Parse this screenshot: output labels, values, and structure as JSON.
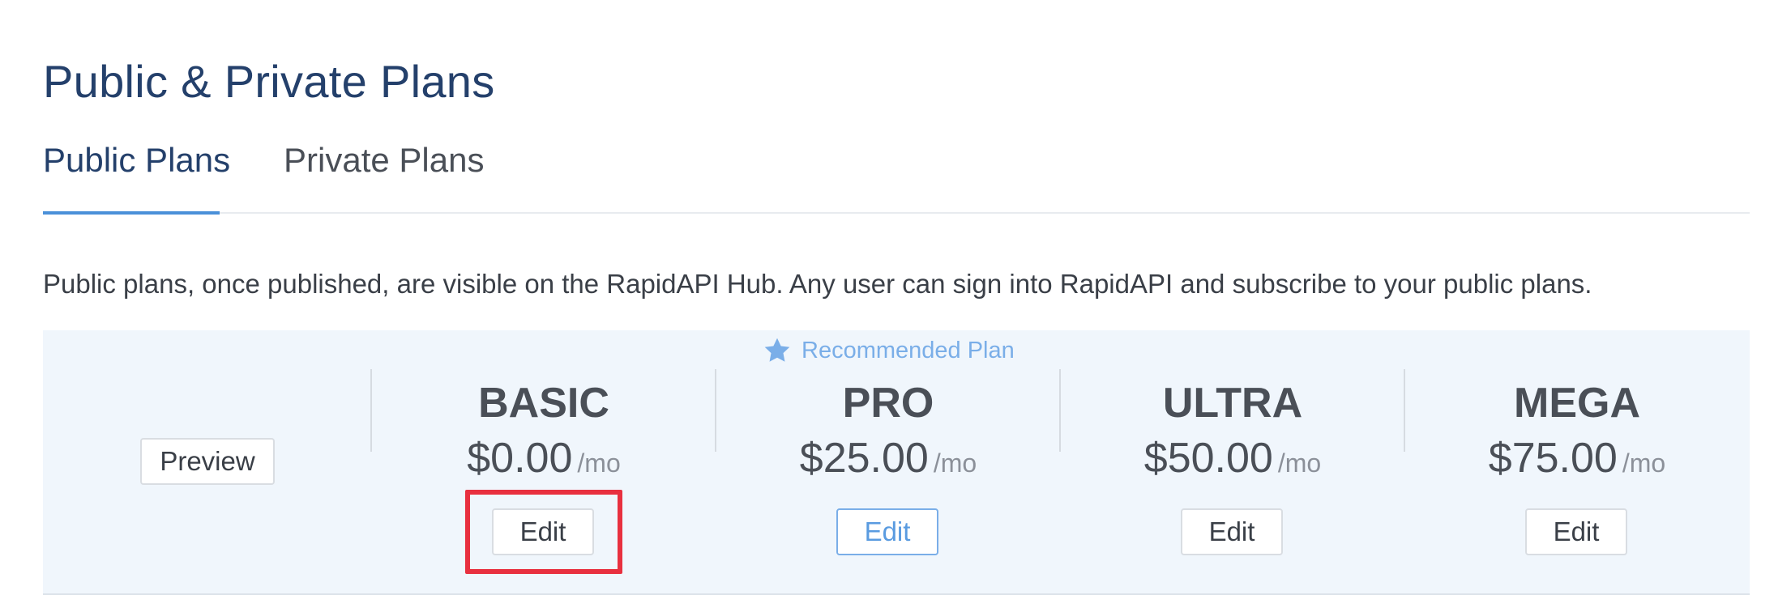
{
  "page": {
    "title": "Public & Private Plans"
  },
  "tabs": [
    {
      "label": "Public Plans",
      "active": true
    },
    {
      "label": "Private Plans",
      "active": false
    }
  ],
  "description": "Public plans, once published, are visible on the RapidAPI Hub. Any user can sign into RapidAPI and subscribe to your public plans.",
  "plans_panel": {
    "preview_label": "Preview",
    "recommended_label": "Recommended Plan",
    "recommended_icon": "star-icon",
    "plans": [
      {
        "name": "BASIC",
        "price": "$0.00",
        "unit": "/mo",
        "edit_label": "Edit",
        "recommended": false,
        "highlighted": true
      },
      {
        "name": "PRO",
        "price": "$25.00",
        "unit": "/mo",
        "edit_label": "Edit",
        "recommended": true,
        "highlighted": false
      },
      {
        "name": "ULTRA",
        "price": "$50.00",
        "unit": "/mo",
        "edit_label": "Edit",
        "recommended": false,
        "highlighted": false
      },
      {
        "name": "MEGA",
        "price": "$75.00",
        "unit": "/mo",
        "edit_label": "Edit",
        "recommended": false,
        "highlighted": false
      }
    ]
  },
  "colors": {
    "title": "#24406b",
    "tab_active_underline": "#4a90d9",
    "panel_background": "#f0f6fc",
    "recommended_accent": "#7aaee8",
    "highlight": "#e8303f"
  }
}
